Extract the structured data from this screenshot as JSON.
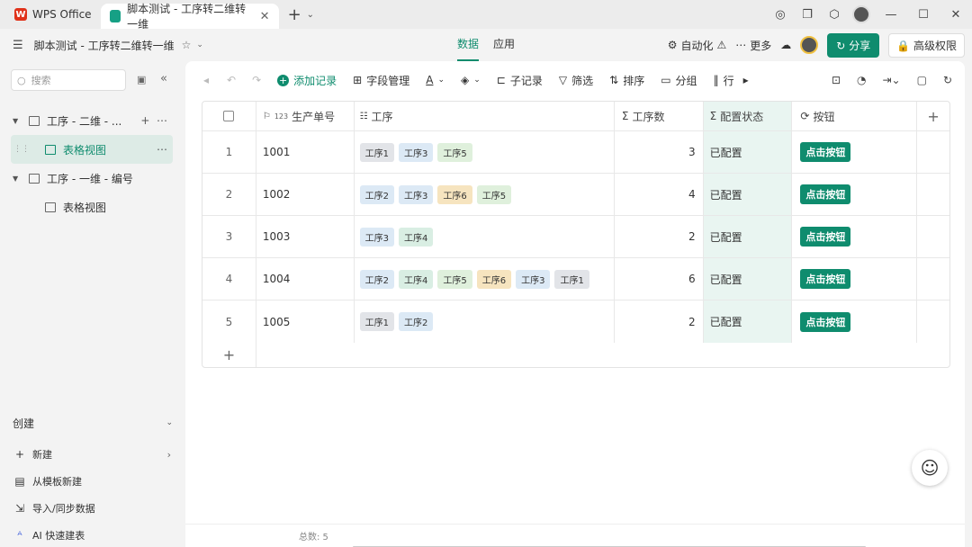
{
  "titlebar": {
    "wps_tab": "WPS Office",
    "doc_tab": "脚本测试 - 工序转二维转一维",
    "close": "✕",
    "add": "+",
    "more": "⌄"
  },
  "bar2": {
    "doc_title": "脚本测试 - 工序转二维转一维",
    "tabs": [
      "数据",
      "应用"
    ],
    "automation": "自动化",
    "more": "更多",
    "share": "分享",
    "permissions": "高级权限"
  },
  "sidebar": {
    "search_placeholder": "搜索",
    "tree": [
      {
        "label": "工序 - 二维 - ..."
      },
      {
        "label": "表格视图"
      },
      {
        "label": "工序 - 一维 - 编号"
      },
      {
        "label": "表格视图"
      }
    ],
    "create": {
      "header": "创建",
      "items": [
        "新建",
        "从模板新建",
        "导入/同步数据",
        "AI 快速建表"
      ]
    }
  },
  "toolbar": {
    "add_record": "添加记录",
    "field_manage": "字段管理",
    "sub_record": "子记录",
    "filter": "筛选",
    "sort": "排序",
    "group": "分组",
    "row": "行"
  },
  "table": {
    "headers": {
      "id": "生产单号",
      "id_prefix": "123",
      "process": "工序",
      "count": "工序数",
      "status": "配置状态",
      "button": "按钮"
    },
    "rows": [
      {
        "num": "1",
        "id": "1001",
        "tags": [
          "工序1",
          "工序3",
          "工序5"
        ],
        "count": "3",
        "status": "已配置",
        "btn": "点击按钮"
      },
      {
        "num": "2",
        "id": "1002",
        "tags": [
          "工序2",
          "工序3",
          "工序6",
          "工序5"
        ],
        "count": "4",
        "status": "已配置",
        "btn": "点击按钮"
      },
      {
        "num": "3",
        "id": "1003",
        "tags": [
          "工序3",
          "工序4"
        ],
        "count": "2",
        "status": "已配置",
        "btn": "点击按钮"
      },
      {
        "num": "4",
        "id": "1004",
        "tags": [
          "工序2",
          "工序4",
          "工序5",
          "工序6",
          "工序3",
          "工序1"
        ],
        "count": "6",
        "status": "已配置",
        "btn": "点击按钮"
      },
      {
        "num": "5",
        "id": "1005",
        "tags": [
          "工序1",
          "工序2"
        ],
        "count": "2",
        "status": "已配置",
        "btn": "点击按钮"
      }
    ]
  },
  "footer": {
    "total": "总数: 5"
  },
  "colors": {
    "accent": "#0f8c6e",
    "status_col_bg": "#e9f5f1"
  }
}
